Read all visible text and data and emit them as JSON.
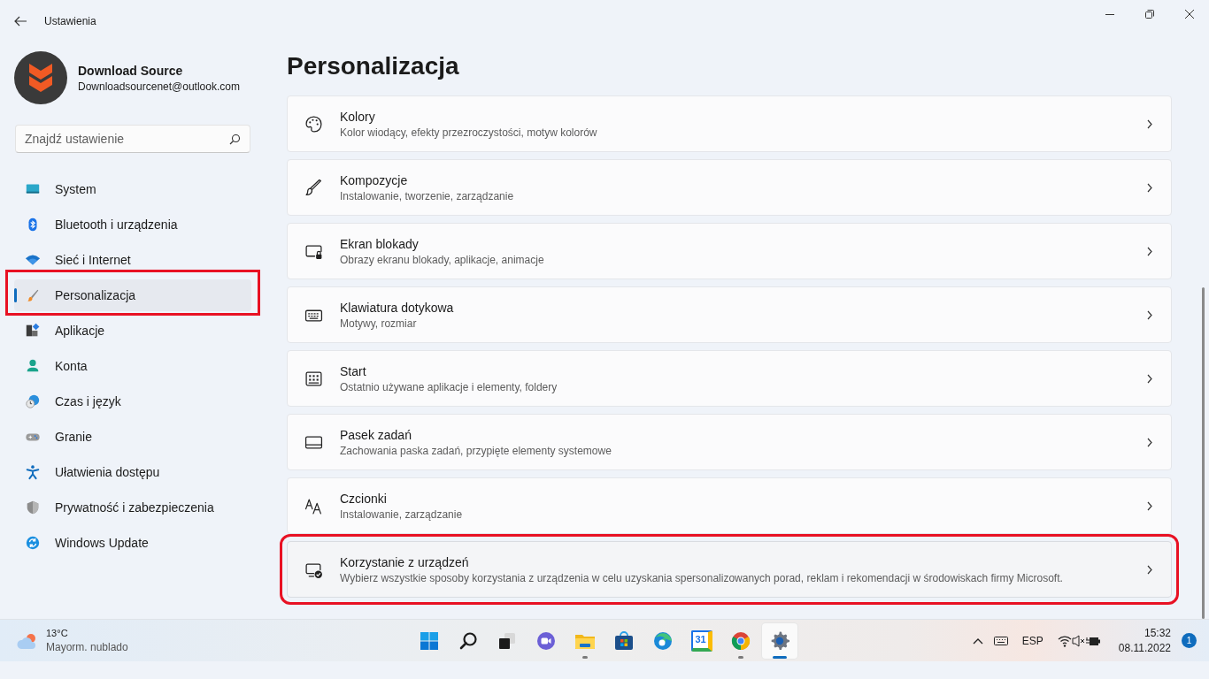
{
  "window": {
    "title": "Ustawienia"
  },
  "account": {
    "name": "Download Source",
    "email": "Downloadsourcenet@outlook.com"
  },
  "search": {
    "placeholder": "Znajdź ustawienie"
  },
  "sidebar": {
    "items": [
      {
        "label": "System",
        "selected": false,
        "highlighted": false
      },
      {
        "label": "Bluetooth i urządzenia",
        "selected": false,
        "highlighted": false
      },
      {
        "label": "Sieć i Internet",
        "selected": false,
        "highlighted": false
      },
      {
        "label": "Personalizacja",
        "selected": true,
        "highlighted": true
      },
      {
        "label": "Aplikacje",
        "selected": false,
        "highlighted": false
      },
      {
        "label": "Konta",
        "selected": false,
        "highlighted": false
      },
      {
        "label": "Czas i język",
        "selected": false,
        "highlighted": false
      },
      {
        "label": "Granie",
        "selected": false,
        "highlighted": false
      },
      {
        "label": "Ułatwienia dostępu",
        "selected": false,
        "highlighted": false
      },
      {
        "label": "Prywatność i zabezpieczenia",
        "selected": false,
        "highlighted": false
      },
      {
        "label": "Windows Update",
        "selected": false,
        "highlighted": false
      }
    ]
  },
  "page": {
    "title": "Personalizacja",
    "cards": [
      {
        "title": "Kolory",
        "description": "Kolor wiodący, efekty przezroczystości, motyw kolorów",
        "highlighted": false
      },
      {
        "title": "Kompozycje",
        "description": "Instalowanie, tworzenie, zarządzanie",
        "highlighted": false
      },
      {
        "title": "Ekran blokady",
        "description": "Obrazy ekranu blokady, aplikacje, animacje",
        "highlighted": false
      },
      {
        "title": "Klawiatura dotykowa",
        "description": "Motywy, rozmiar",
        "highlighted": false
      },
      {
        "title": "Start",
        "description": "Ostatnio używane aplikacje i elementy, foldery",
        "highlighted": false
      },
      {
        "title": "Pasek zadań",
        "description": "Zachowania paska zadań, przypięte elementy systemowe",
        "highlighted": false
      },
      {
        "title": "Czcionki",
        "description": "Instalowanie, zarządzanie",
        "highlighted": false
      },
      {
        "title": "Korzystanie z urządzeń",
        "description": "Wybierz wszystkie sposoby korzystania z urządzenia w celu uzyskania spersonalizowanych porad, reklam i rekomendacji w środowiskach firmy Microsoft.",
        "highlighted": true
      }
    ]
  },
  "taskbar": {
    "weather": {
      "temperature": "13°C",
      "condition": "Mayorm. nublado"
    },
    "apps": [
      {
        "running": false,
        "selected": false
      },
      {
        "running": false,
        "selected": false
      },
      {
        "running": false,
        "selected": false
      },
      {
        "running": false,
        "selected": false
      },
      {
        "running": true,
        "selected": false
      },
      {
        "running": false,
        "selected": false
      },
      {
        "running": false,
        "selected": false
      },
      {
        "running": false,
        "selected": false,
        "label": "31"
      },
      {
        "running": true,
        "selected": false
      },
      {
        "running": true,
        "selected": true
      }
    ],
    "language": "ESP",
    "time": "15:32",
    "date": "08.11.2022",
    "notifications": "1"
  }
}
